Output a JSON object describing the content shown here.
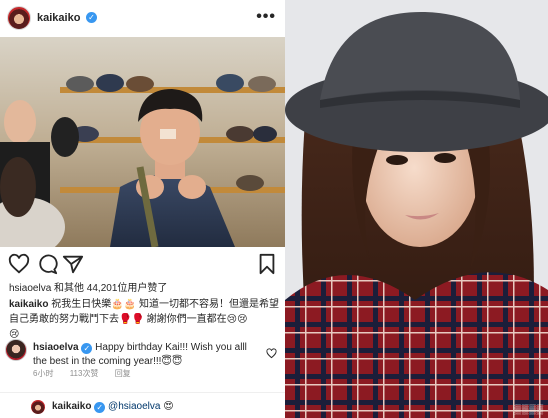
{
  "post": {
    "username": "kaikaiko",
    "verified_mark": "✓",
    "more_label": "•••",
    "likes_text": "hsiaoelva 和其他 44,201位用户赞了",
    "caption_user": "kaikaiko",
    "caption_line1": "祝我生日快樂🎂🎂 知道一切都不容易！但還是希望",
    "caption_line2": "自己勇敢的努力戰鬥下去🥊🥊 謝謝你們一直都在😢😢",
    "caption_line3": "😢"
  },
  "comment": {
    "user": "hsiaoelva",
    "line1": "Happy birthday Kai!!! Wish you alll",
    "line2": "the best in the coming year!!!😇😇",
    "time": "6小时",
    "likes": "113次赞",
    "reply": "回复"
  },
  "reply": {
    "user": "kaikaiko",
    "mention": "@hsiaoelva",
    "emoji": "😍"
  },
  "icons": [
    "more-icon",
    "heart-icon",
    "comment-icon",
    "share-icon",
    "bookmark-icon",
    "verified-icon"
  ],
  "colors": {
    "verified": "#3897f0",
    "mention": "#00376b",
    "meta": "#8e8e8e"
  }
}
